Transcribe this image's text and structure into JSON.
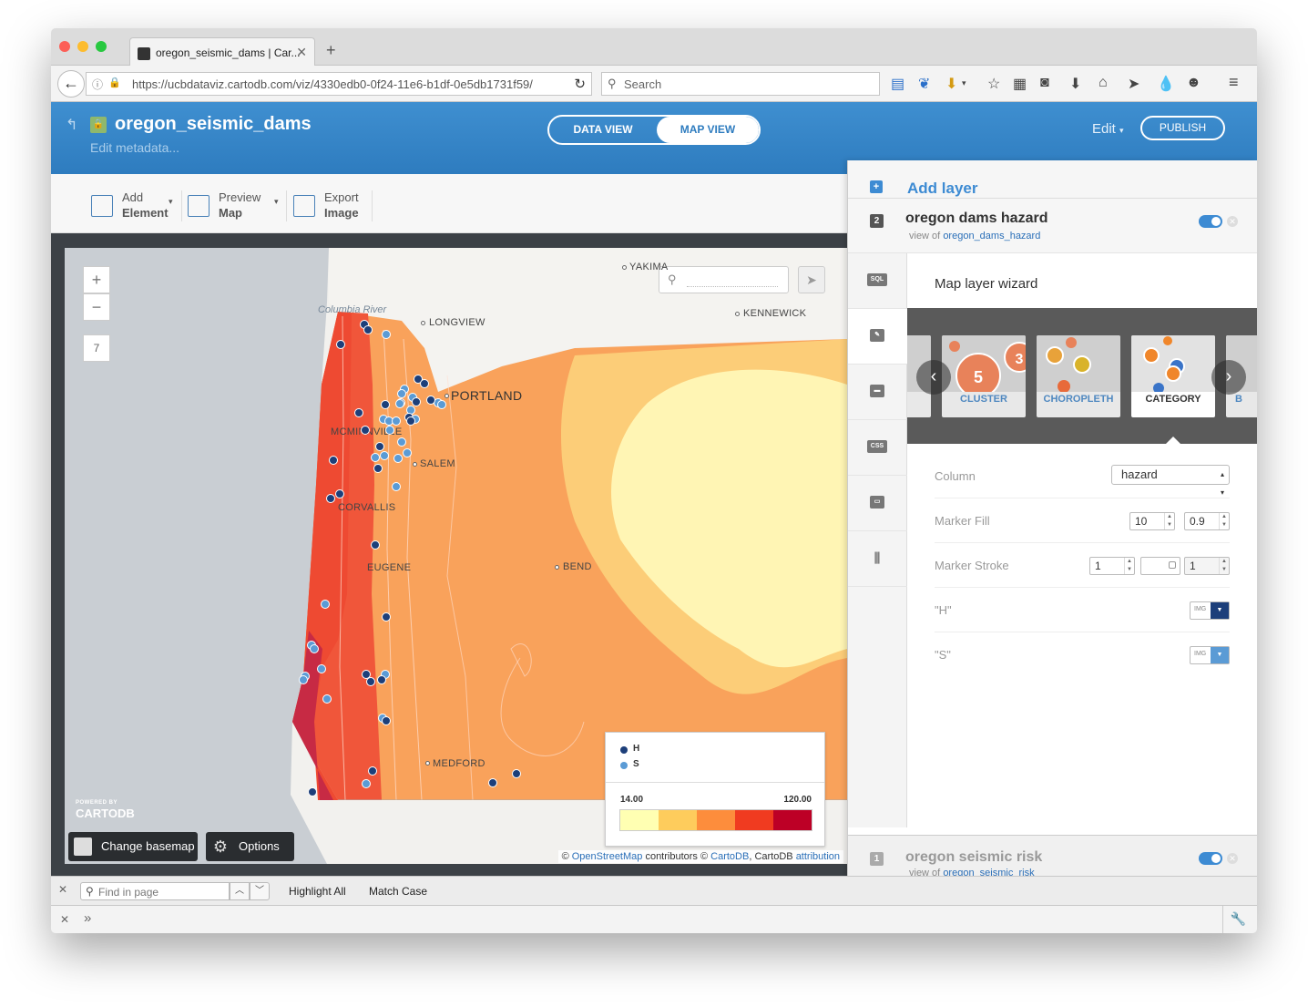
{
  "browser": {
    "tab_title": "oregon_seismic_dams | Car...",
    "new_tab": "+",
    "url": "https://ucbdataviz.cartodb.com/viz/4330edb0-0f24-11e6-b1df-0e5db1731f59/",
    "search_placeholder": "Search"
  },
  "header": {
    "title": "oregon_seismic_dams",
    "edit_metadata": "Edit metadata...",
    "data_view": "DATA VIEW",
    "map_view": "MAP VIEW",
    "edit": "Edit",
    "publish": "PUBLISH"
  },
  "toolbar": {
    "add_element": [
      "Add",
      "Element"
    ],
    "preview_map": [
      "Preview",
      "Map"
    ],
    "export_image": [
      "Export",
      "Image"
    ]
  },
  "map": {
    "zoom_in": "+",
    "zoom_out": "−",
    "zoom_level": "7",
    "river_label": "Columbia River",
    "cities": {
      "yakima": "YAKIMA",
      "kennewick": "KENNEWICK",
      "longview": "LONGVIEW",
      "portland": "PORTLAND",
      "mcminnville": "MCMINNVILLE",
      "salem": "SALEM",
      "corvallis": "CORVALLIS",
      "eugene": "EUGENE",
      "bend": "BEND",
      "medford": "MEDFORD"
    },
    "powered_by": "POWERED BY",
    "brand": "CARTODB",
    "change_basemap": "Change basemap",
    "options": "Options",
    "attribution": {
      "prefix": "© ",
      "osm": "OpenStreetMap",
      "mid": " contributors © ",
      "cartodb": "CartoDB",
      "mid2": ", CartoDB ",
      "attr": "attribution"
    },
    "dam_colors": {
      "H": "#1d3f7a",
      "S": "#5b9bd5"
    }
  },
  "legend": {
    "categories": [
      {
        "label": "H",
        "color": "#1d3f7a"
      },
      {
        "label": "S",
        "color": "#5b9bd5"
      }
    ],
    "min": "14.00",
    "max": "120.00",
    "ramp": [
      "#ffffb2",
      "#fecc5c",
      "#fd8d3c",
      "#f03b20",
      "#bd0026"
    ]
  },
  "panel": {
    "add_layer": "Add layer",
    "layer2": {
      "num": "2",
      "name": "oregon dams hazard",
      "view_of": "view of",
      "source": "oregon_dams_hazard"
    },
    "layer1": {
      "num": "1",
      "name": "oregon seismic risk",
      "view_of": "view of",
      "source": "oregon_seismic_risk"
    },
    "sidebar_icons": [
      "SQL",
      "wizard-icon",
      "infowindow-icon",
      "CSS",
      "legend-icon",
      "filter-icon"
    ],
    "wizard": {
      "title": "Map layer wizard",
      "cards": [
        "CLUSTER",
        "CHOROPLETH",
        "CATEGORY",
        "B"
      ],
      "cluster_values": [
        "5",
        "3"
      ],
      "column_label": "Column",
      "column_value": "hazard",
      "marker_fill_label": "Marker Fill",
      "marker_fill_width": "10",
      "marker_fill_opacity": "0.9",
      "marker_stroke_label": "Marker Stroke",
      "marker_stroke_width": "1",
      "marker_stroke_opacity": "1",
      "cat_h_label": "\"H\"",
      "cat_s_label": "\"S\"",
      "img": "IMG"
    }
  },
  "findbar": {
    "placeholder": "Find in page",
    "highlight_all": "Highlight All",
    "match_case": "Match Case"
  }
}
